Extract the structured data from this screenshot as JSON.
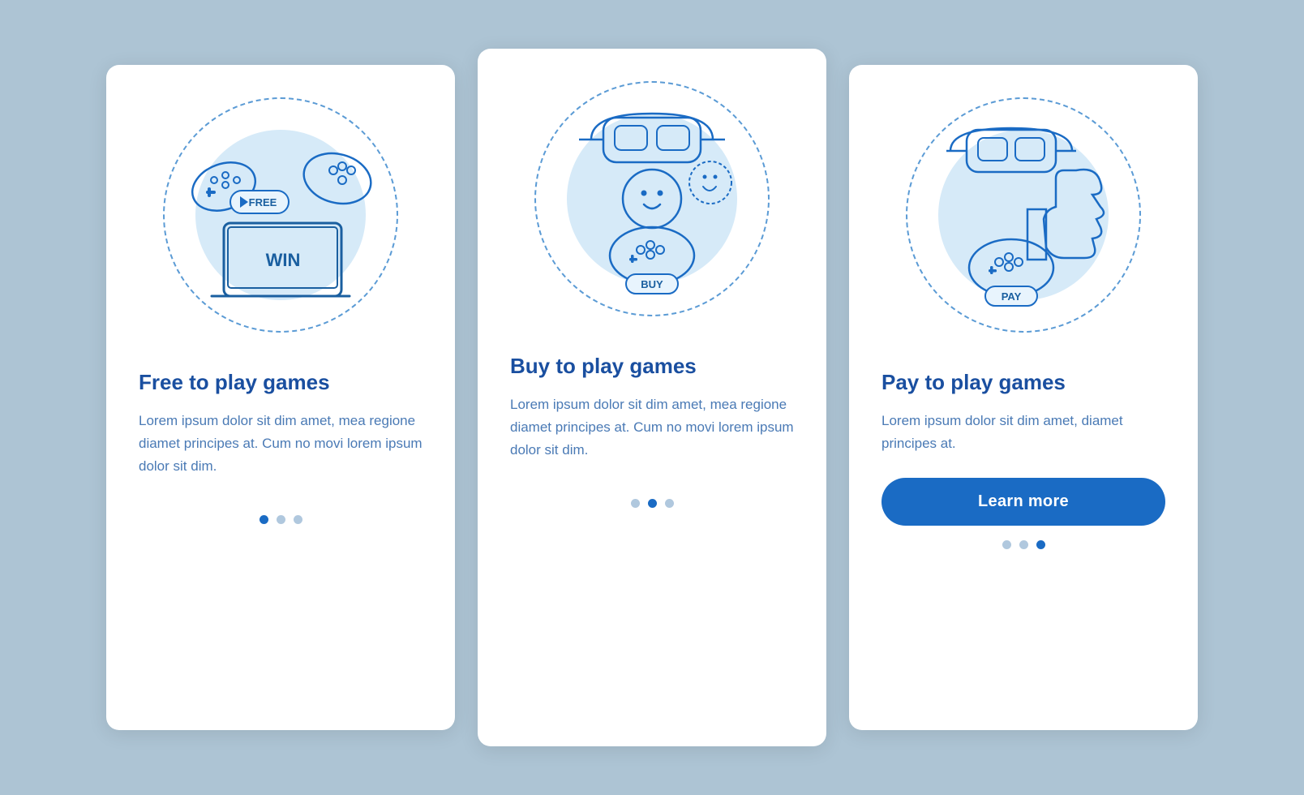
{
  "cards": [
    {
      "id": "free-to-play",
      "title": "Free to play games",
      "text": "Lorem ipsum dolor sit dim amet, mea regione diamet principes at. Cum no movi lorem ipsum dolor sit dim.",
      "dots": [
        true,
        false,
        false
      ],
      "hasButton": false,
      "buttonLabel": ""
    },
    {
      "id": "buy-to-play",
      "title": "Buy to play games",
      "text": "Lorem ipsum dolor sit dim amet, mea regione diamet principes at. Cum no movi lorem ipsum dolor sit dim.",
      "dots": [
        false,
        true,
        false
      ],
      "hasButton": false,
      "buttonLabel": ""
    },
    {
      "id": "pay-to-play",
      "title": "Pay to play games",
      "text": "Lorem ipsum dolor sit dim amet, diamet principes at.",
      "dots": [
        false,
        false,
        true
      ],
      "hasButton": true,
      "buttonLabel": "Learn more"
    }
  ]
}
